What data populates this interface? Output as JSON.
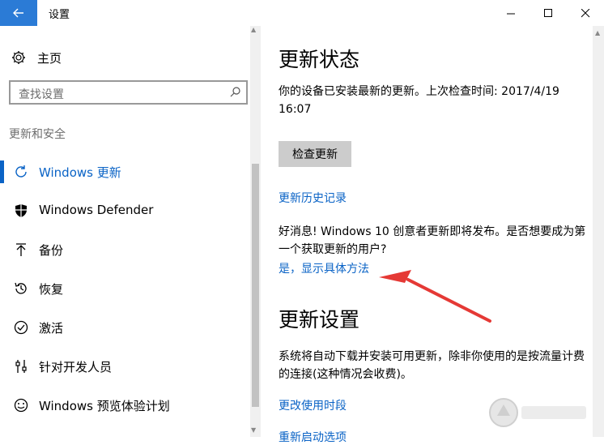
{
  "window": {
    "title": "设置",
    "accent": "#2b7bd6",
    "link_color": "#0a63c6"
  },
  "sidebar": {
    "home_label": "主页",
    "search_placeholder": "查找设置",
    "section_title": "更新和安全",
    "items": [
      {
        "label": "Windows 更新",
        "icon": "refresh-icon",
        "active": true
      },
      {
        "label": "Windows Defender",
        "icon": "shield-icon"
      },
      {
        "label": "备份",
        "icon": "backup-arrow-icon"
      },
      {
        "label": "恢复",
        "icon": "history-icon"
      },
      {
        "label": "激活",
        "icon": "check-circle-icon"
      },
      {
        "label": "针对开发人员",
        "icon": "developer-sliders-icon"
      },
      {
        "label": "Windows 预览体验计划",
        "icon": "insider-smile-icon"
      }
    ]
  },
  "main": {
    "status_heading": "更新状态",
    "status_text": "你的设备已安装最新的更新。上次检查时间: 2017/4/19 16:07",
    "check_button": "检查更新",
    "history_link": "更新历史记录",
    "news_text": "好消息! Windows 10 创意者更新即将发布。是否想要成为第一个获取更新的用户?",
    "news_link": "是，显示具体方法",
    "settings_heading": "更新设置",
    "settings_text": "系统将自动下载并安装可用更新，除非你使用的是按流量计费的连接(这种情况会收费)。",
    "active_hours_link": "更改使用时段",
    "restart_link": "重新启动选项"
  }
}
